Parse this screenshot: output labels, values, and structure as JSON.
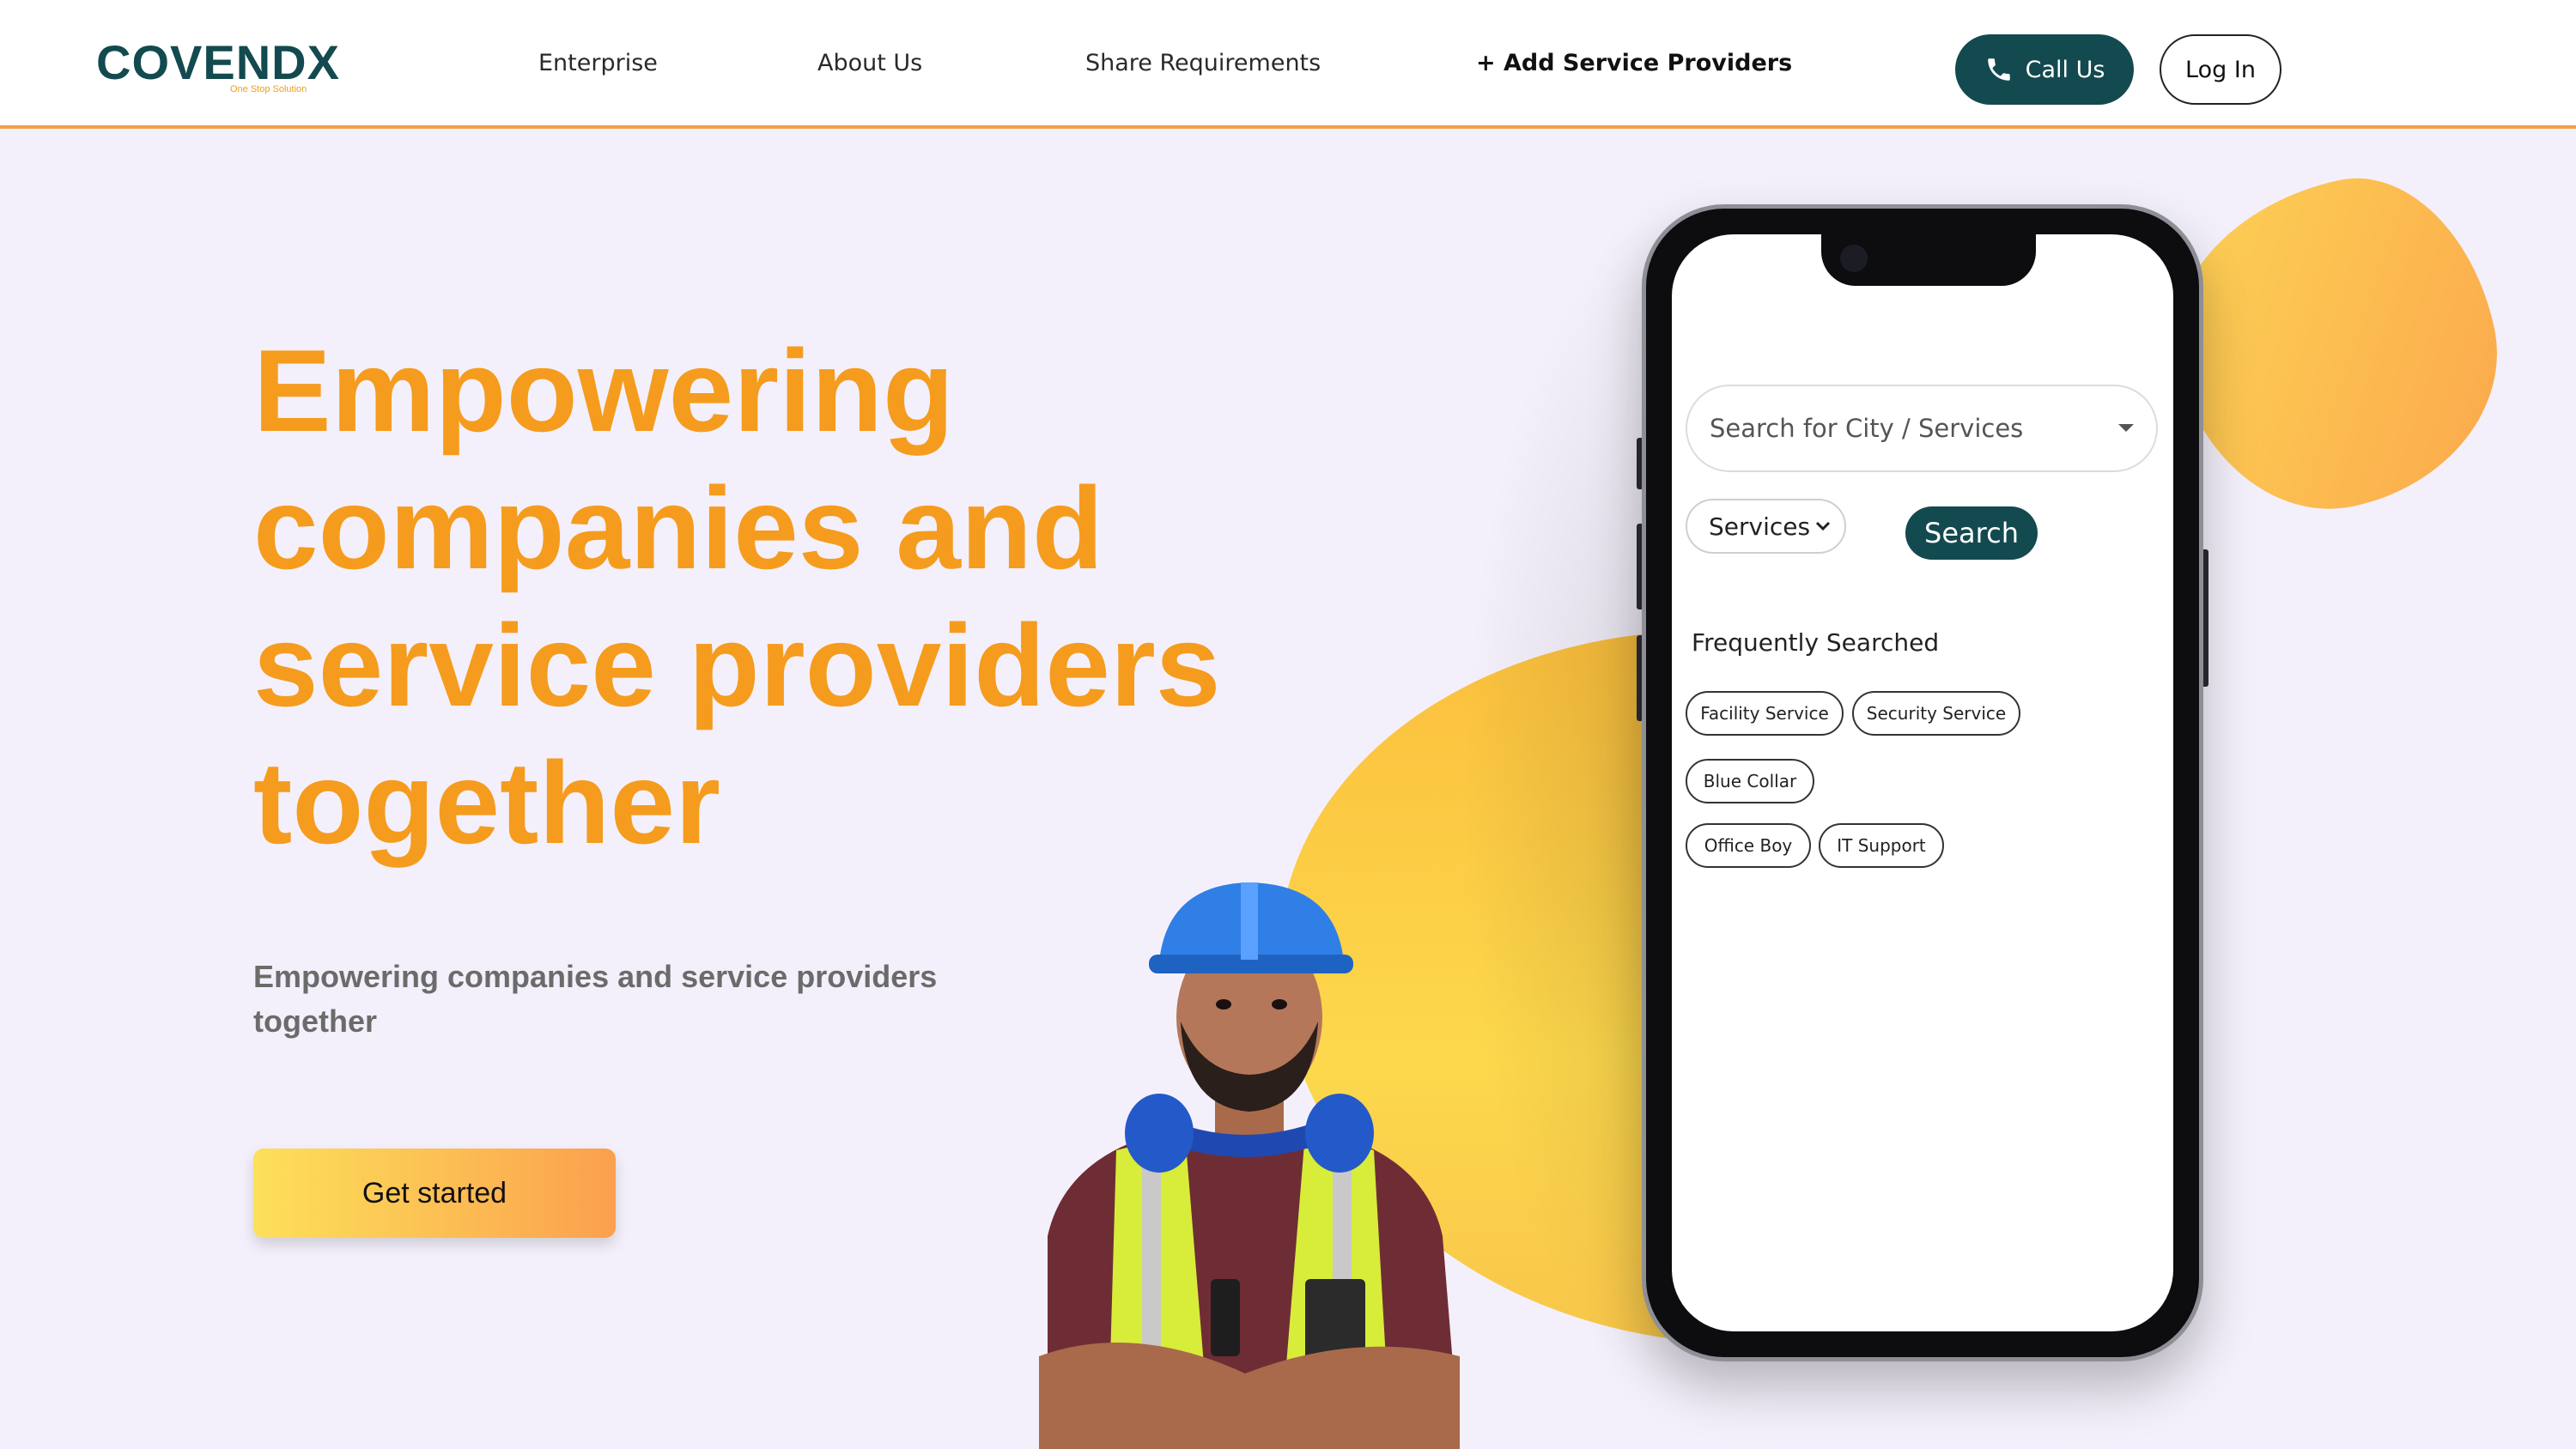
{
  "header": {
    "logo_text": "COVENDX",
    "logo_tagline": "One Stop Solution",
    "nav": [
      {
        "label": "Enterprise"
      },
      {
        "label": "About Us"
      },
      {
        "label": "Share Requirements"
      },
      {
        "label": "+ Add Service Providers"
      }
    ],
    "call_label": "Call Us",
    "login_label": "Log In"
  },
  "hero": {
    "title_lines": [
      "Empowering",
      "companies and",
      "service providers",
      "together"
    ],
    "subtitle": "Empowering companies and service providers together",
    "cta_label": "Get started"
  },
  "phone": {
    "search_placeholder": "Search for City / Services",
    "category_select": "Services",
    "search_button": "Search",
    "frequently_searched_title": "Frequently Searched",
    "chips": [
      "Facility Service",
      "Security Service",
      "Blue Collar",
      "Office Boy",
      "IT Support"
    ]
  },
  "colors": {
    "brand_teal": "#134a4f",
    "accent_orange": "#f59c1e",
    "page_bg": "#f4f0fb"
  },
  "icons": [
    "phone-icon",
    "chevron-down-icon",
    "select-arrow-icon"
  ]
}
